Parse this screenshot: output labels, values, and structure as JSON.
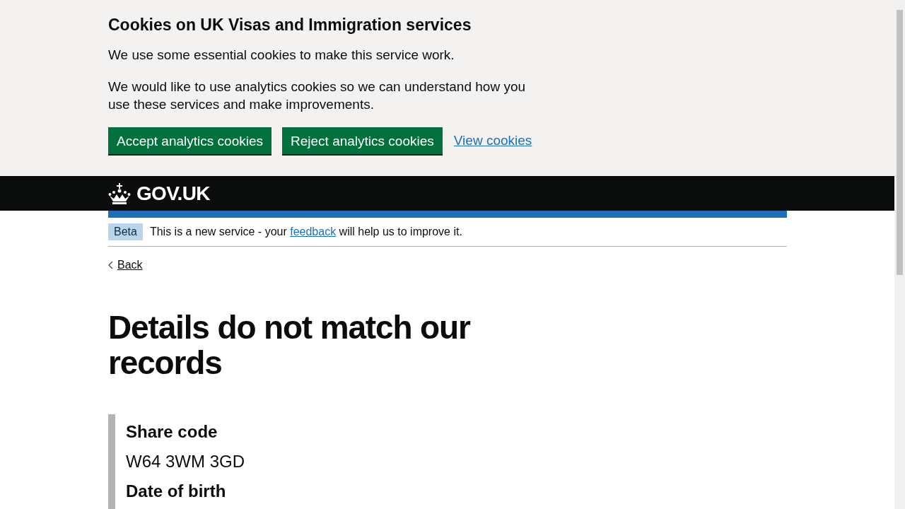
{
  "cookie_banner": {
    "title": "Cookies on UK Visas and Immigration services",
    "paragraphs": [
      "We use some essential cookies to make this service work.",
      "We would like to use analytics cookies so we can understand how you use these services and make improvements."
    ],
    "buttons": [
      "Accept analytics cookies",
      "Reject analytics cookies"
    ],
    "link": "View cookies"
  },
  "header": {
    "logo_text": "GOV.UK"
  },
  "phase_banner": {
    "tag": "Beta",
    "text_before": "This is a new service - your ",
    "link": "feedback",
    "text_after": " will help us to improve it."
  },
  "back_link": "Back",
  "heading": "Details do not match our records",
  "details": [
    {
      "label": "Share code",
      "value": "W64 3WM 3GD"
    },
    {
      "label": "Date of birth"
    }
  ]
}
